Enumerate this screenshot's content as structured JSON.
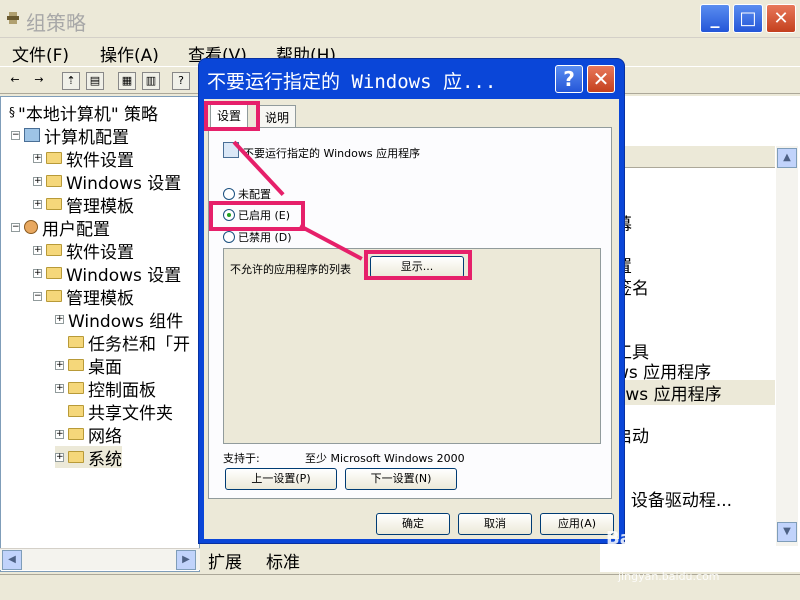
{
  "window": {
    "title": "组策略"
  },
  "menu": [
    "文件(F)",
    "操作(A)",
    "查看(V)",
    "帮助(H)"
  ],
  "tree": {
    "root": "\"本地计算机\" 策略",
    "computer_config": "计算机配置",
    "software_settings": "软件设置",
    "windows_settings": "Windows 设置",
    "admin_templates": "管理模板",
    "user_config": "用户配置",
    "user_software_settings": "软件设置",
    "user_windows_settings": "Windows 设置",
    "user_admin_templates": "管理模板",
    "windows_components": "Windows 组件",
    "taskbar": "任务栏和「开",
    "desktop": "桌面",
    "control_panel": "控制面板",
    "shared_folders": "共享文件夹",
    "network": "网络",
    "system": "系统"
  },
  "right_partial": [
    "幕",
    "置",
    "签名",
    "工具",
    "ws 应用程序",
    "ows 应用程序",
    "启动",
    "e 设备驱动程..."
  ],
  "view_tabs": [
    "扩展",
    "标准"
  ],
  "dialog": {
    "title": "不要运行指定的 Windows 应...",
    "help": "?",
    "close": "✕",
    "tabs": [
      "设置",
      "说明"
    ],
    "policy_name": "不要运行指定的 Windows 应用程序",
    "radio_not_configured": "未配置",
    "radio_enabled": "已启用 (E)",
    "radio_disabled": "已禁用 (D)",
    "selected": "enabled",
    "options_label": "不允许的应用程序的列表",
    "show_button": "显示...",
    "supported_label": "支持于:",
    "supported_value": "至少 Microsoft Windows 2000",
    "prev_button": "上一设置(P)",
    "next_button": "下一设置(N)",
    "ok": "确定",
    "cancel": "取消",
    "apply": "应用(A)"
  },
  "watermark": {
    "brand": "Baidu 经验",
    "url": "jingyan.baidu.com"
  },
  "colors": {
    "highlight": "#e6206a",
    "titlebar": "#0a46d8"
  }
}
